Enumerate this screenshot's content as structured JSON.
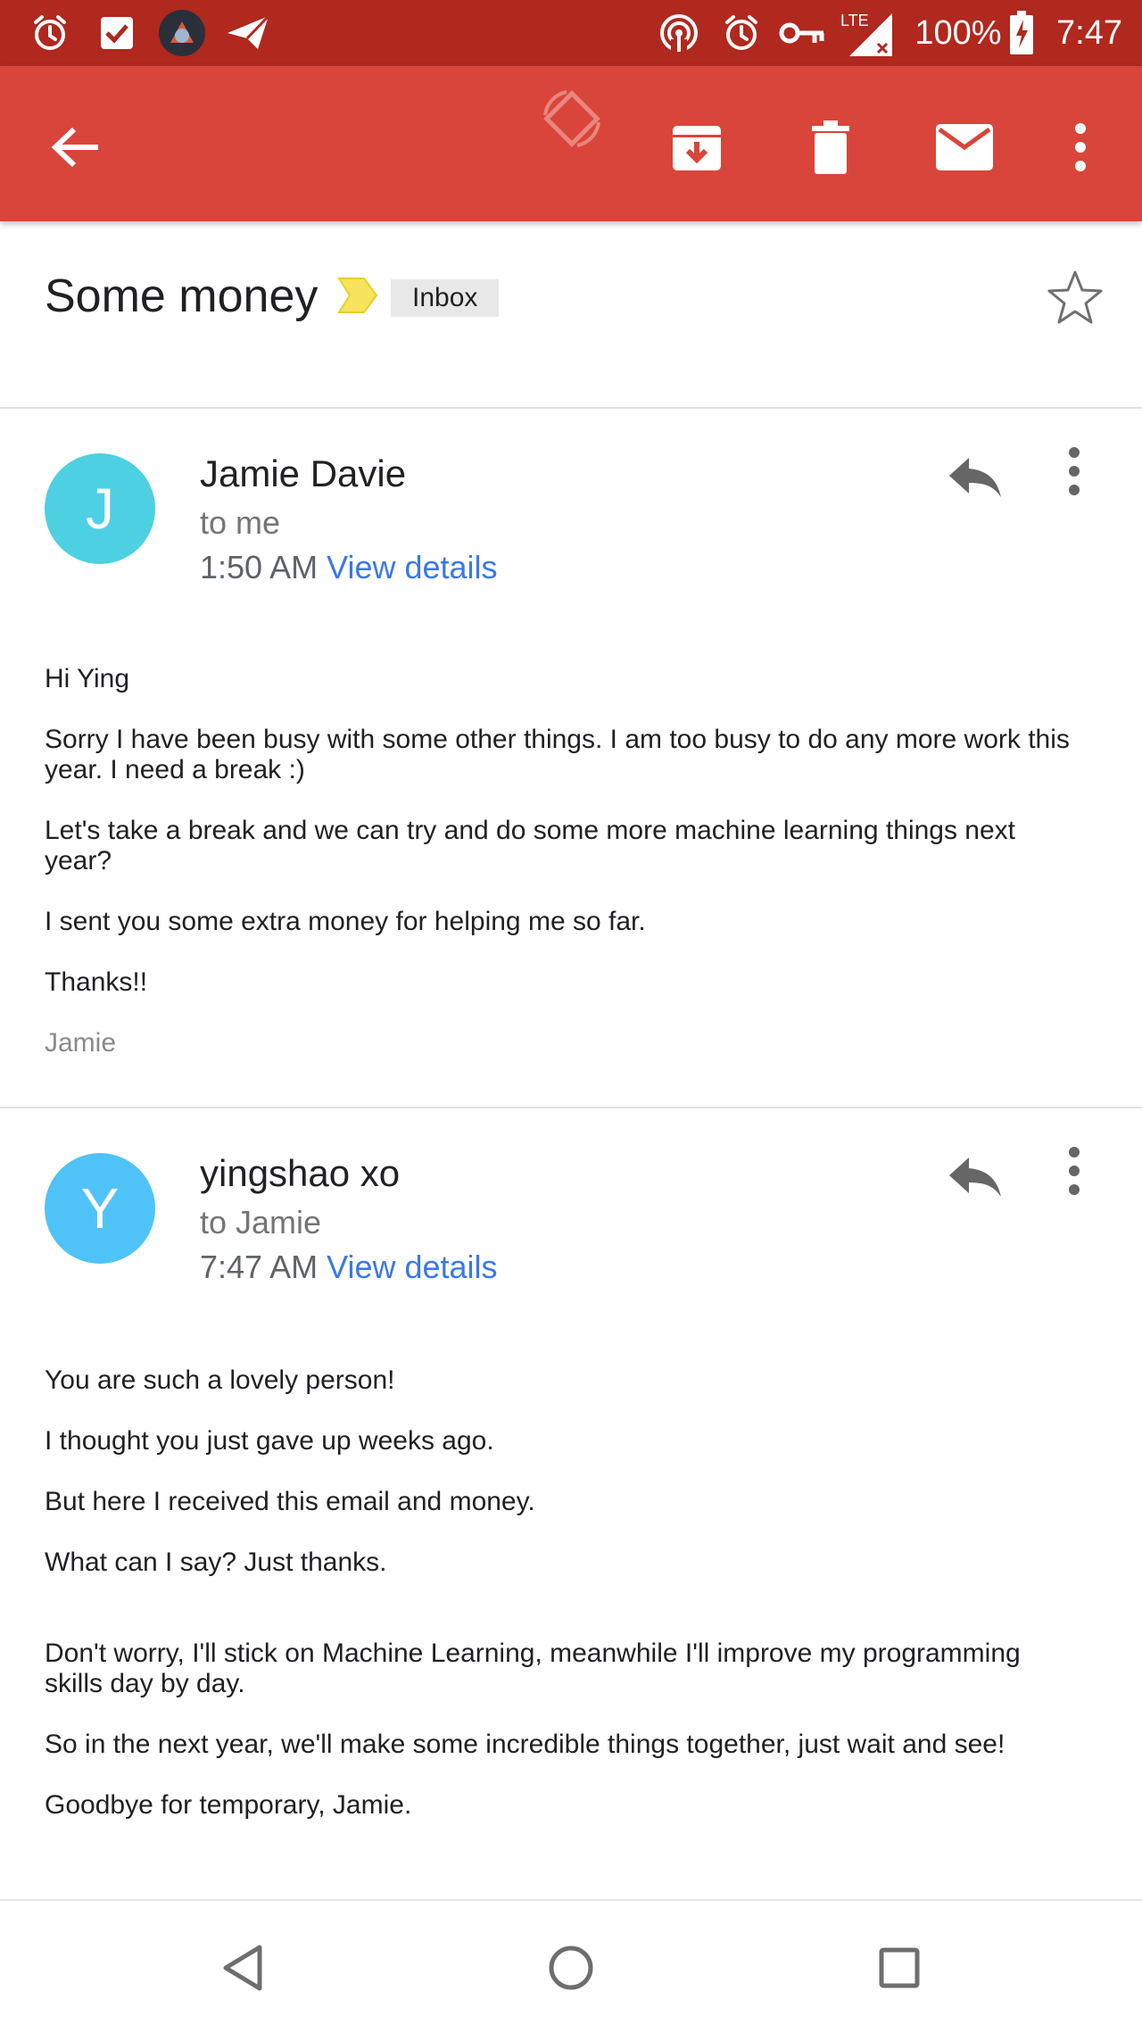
{
  "status_bar": {
    "battery": "100%",
    "time": "7:47",
    "network": "LTE",
    "icons": [
      "alarm-icon",
      "checkbox-icon",
      "app-avatar-icon",
      "send-icon",
      "hotspot-icon",
      "alarm-icon",
      "vpn-key-icon",
      "signal-icon",
      "battery-charging-icon"
    ]
  },
  "app_bar": {
    "actions": [
      "back-arrow-icon",
      "rotate-icon",
      "archive-icon",
      "delete-icon",
      "mark-unread-icon",
      "more-vert-icon"
    ],
    "color": "#d9453a"
  },
  "subject": {
    "title": "Some money",
    "label": "Inbox",
    "importance_color": "#f7e35c"
  },
  "messages": [
    {
      "avatar_letter": "J",
      "avatar_color": "#4dd0e1",
      "sender": "Jamie Davie",
      "recipient": "to me",
      "time": "1:50 AM",
      "details_link": "View details",
      "body": [
        "Hi Ying",
        "Sorry I have been busy with some other things.  I am too busy to do any more work this",
        "year.  I need a break :)",
        "Let's take a break and we can try and do some more machine learning things next",
        "year?",
        "I sent you some extra money for helping me so far.",
        "Thanks!!"
      ],
      "signature": "Jamie"
    },
    {
      "avatar_letter": "Y",
      "avatar_color": "#4fc3f7",
      "sender": "yingshao xo",
      "recipient": "to Jamie",
      "time": "7:47 AM",
      "details_link": "View details",
      "body": [
        "You are such a lovely person!",
        "I thought you just gave up weeks ago.",
        "But here I received this email and money.",
        "What can I say? Just thanks.",
        "Don't worry, I'll stick on Machine Learning, meanwhile I'll improve my programming",
        "skills day by day.",
        "So in the next year, we'll make some incredible things together, just wait and see!",
        "Goodbye for temporary, Jamie."
      ]
    }
  ],
  "nav_bar": {
    "buttons": [
      "back-triangle-icon",
      "home-circle-icon",
      "recents-square-icon"
    ]
  }
}
